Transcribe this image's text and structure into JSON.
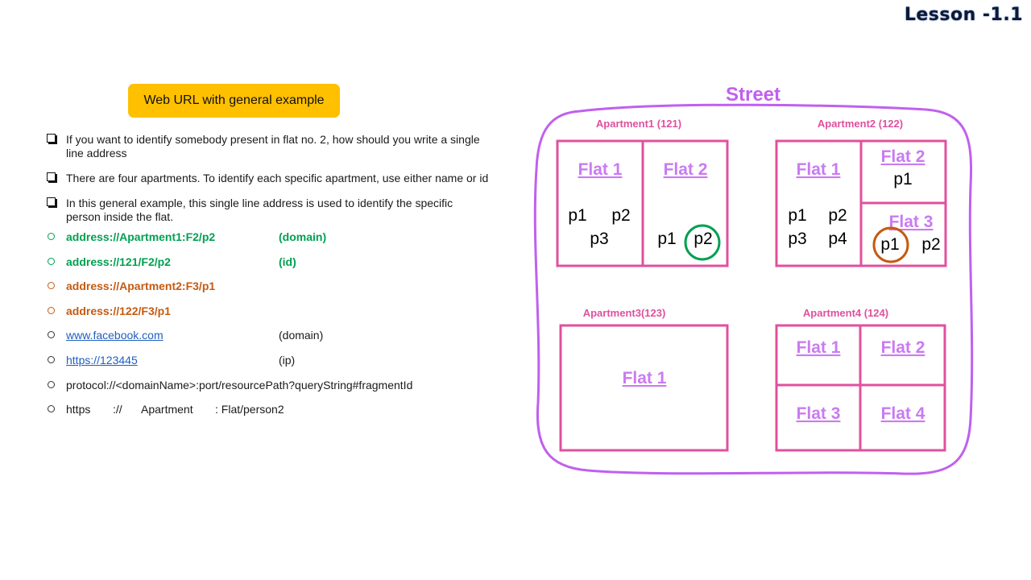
{
  "lesson": "Lesson -1.1",
  "badge": "Web URL with general example",
  "bullets": [
    "If you want to identify somebody present in flat no. 2, how should you write a single line address",
    "There are four apartments. To identify each specific apartment, use either name or id",
    "In this general example, this single line address is used to identify the specific person inside the flat."
  ],
  "examples": [
    {
      "text": "address://Apartment1:F2/p2",
      "note": "(domain)",
      "style": "green"
    },
    {
      "text": "address://121/F2/p2",
      "note": "(id)",
      "style": "green"
    },
    {
      "text": "address://Apartment2:F3/p1",
      "note": "",
      "style": "orange"
    },
    {
      "text": "address://122/F3/p1",
      "note": "",
      "style": "orange"
    },
    {
      "text": "www.facebook.com",
      "note": "(domain)",
      "style": "link"
    },
    {
      "text": "https://123445",
      "note": "(ip)",
      "style": "link"
    },
    {
      "text": "protocol://<domainName>:port/resourcePath?queryString#fragmentId",
      "note": "",
      "style": "plain"
    }
  ],
  "last_line": {
    "p1": "https",
    "p2": "://",
    "p3": "Apartment",
    "p4": ": Flat/person2"
  },
  "diagram": {
    "street": "Street",
    "apt1": {
      "label": "Apartment1 (121)",
      "flat1": "Flat 1",
      "flat2": "Flat 2",
      "f1_p1": "p1",
      "f1_p2": "p2",
      "f1_p3": "p3",
      "f2_p1": "p1",
      "f2_p2": "p2"
    },
    "apt2": {
      "label": "Apartment2 (122)",
      "flat1": "Flat 1",
      "flat2": "Flat 2",
      "flat3": "Flat 3",
      "f1_p1": "p1",
      "f1_p2": "p2",
      "f1_p3": "p3",
      "f1_p4": "p4",
      "f2_p1": "p1",
      "f3_p1": "p1",
      "f3_p2": "p2"
    },
    "apt3": {
      "label": "Apartment3(123)",
      "flat1": "Flat 1"
    },
    "apt4": {
      "label": "Apartment4 (124)",
      "flat1": "Flat 1",
      "flat2": "Flat 2",
      "flat3": "Flat 3",
      "flat4": "Flat 4"
    },
    "colors": {
      "street": "#c060f0",
      "box": "#e0509e",
      "flat_label": "#c97bf0",
      "highlight_green": "#00a050",
      "highlight_orange": "#c55a11"
    }
  }
}
